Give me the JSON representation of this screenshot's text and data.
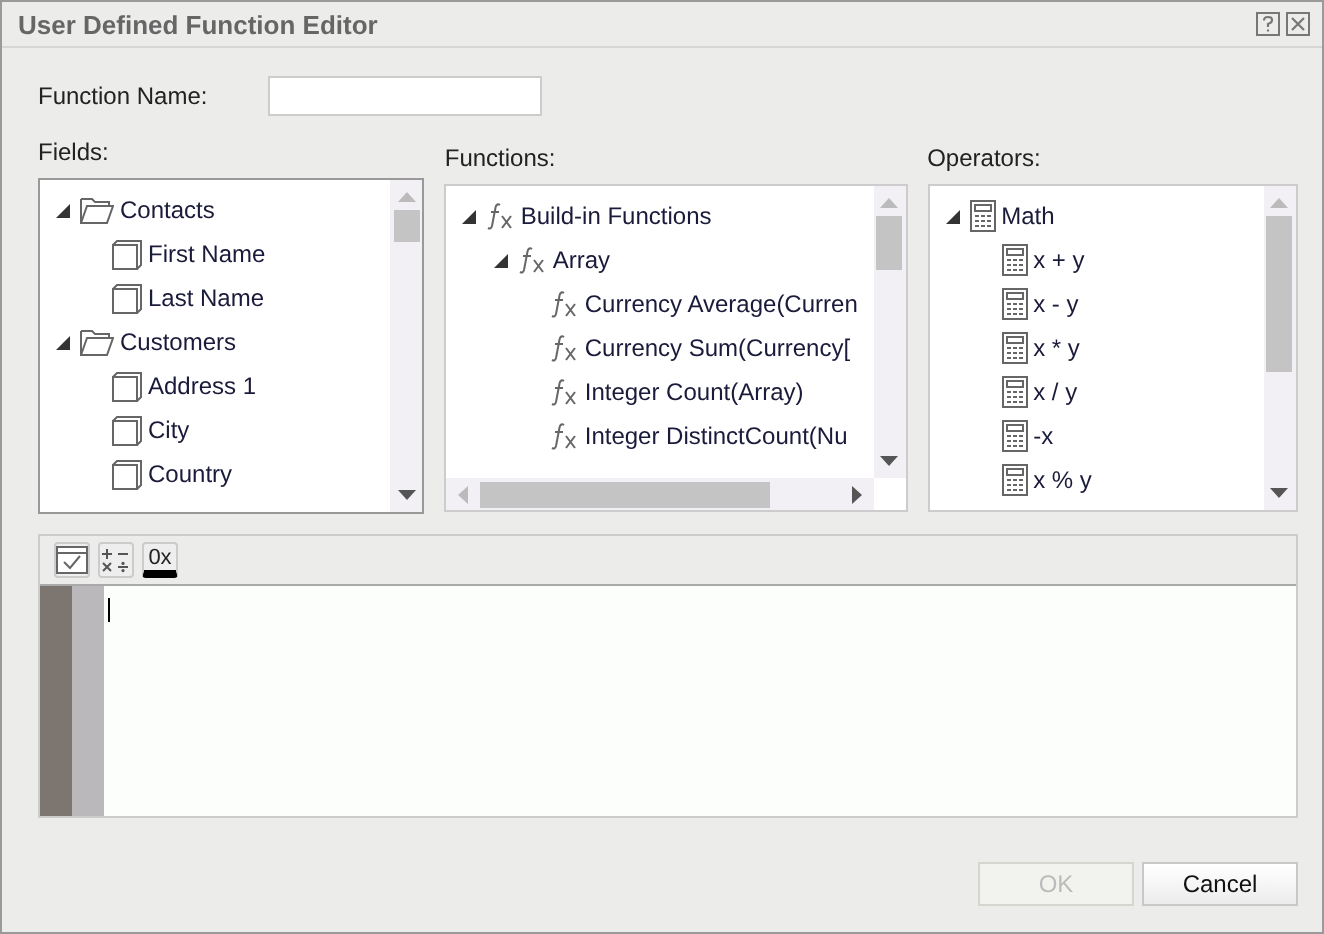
{
  "window": {
    "title": "User Defined Function Editor"
  },
  "function_name": {
    "label": "Function Name:"
  },
  "fields": {
    "label": "Fields:",
    "items": [
      {
        "label": "Contacts",
        "expanded": true,
        "children": [
          {
            "label": "First Name"
          },
          {
            "label": "Last Name"
          }
        ]
      },
      {
        "label": "Customers",
        "expanded": true,
        "children": [
          {
            "label": "Address 1"
          },
          {
            "label": "City"
          },
          {
            "label": "Country"
          }
        ]
      }
    ]
  },
  "functions": {
    "label": "Functions:",
    "items": [
      {
        "label": "Build-in Functions",
        "expanded": true,
        "children": [
          {
            "label": "Array",
            "expanded": true,
            "children": [
              {
                "label": "Currency Average(Curren"
              },
              {
                "label": "Currency Sum(Currency["
              },
              {
                "label": "Integer Count(Array)"
              },
              {
                "label": "Integer DistinctCount(Nu"
              }
            ]
          }
        ]
      }
    ]
  },
  "operators": {
    "label": "Operators:",
    "items": [
      {
        "label": "Math",
        "expanded": true,
        "children": [
          {
            "label": "x + y"
          },
          {
            "label": "x - y"
          },
          {
            "label": "x * y"
          },
          {
            "label": "x / y"
          },
          {
            "label": "-x"
          },
          {
            "label": "x % y"
          }
        ]
      }
    ]
  },
  "editor": {
    "toolbar_text": "0x"
  },
  "buttons": [
    {
      "label": "OK",
      "disabled": true
    },
    {
      "label": "Cancel",
      "disabled": false
    }
  ]
}
